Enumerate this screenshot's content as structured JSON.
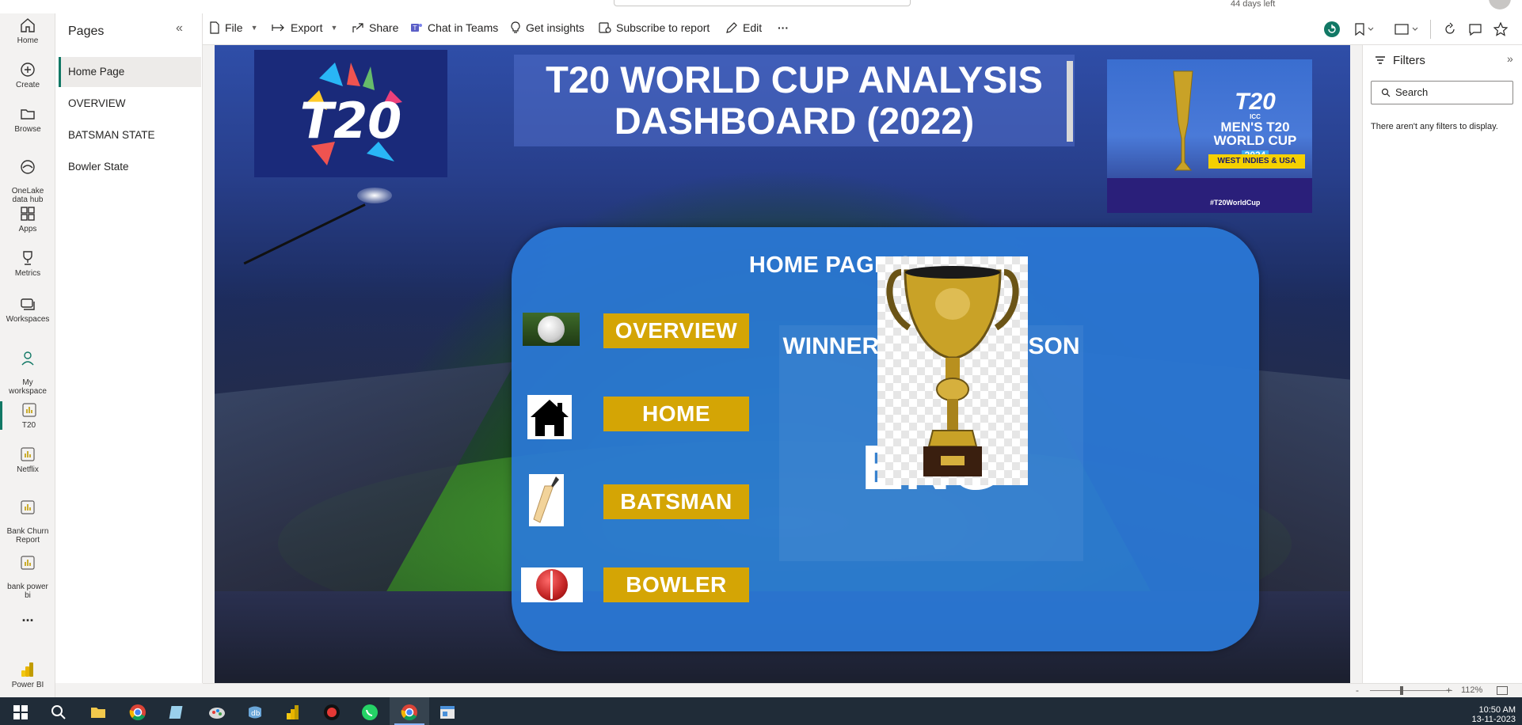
{
  "topbar": {
    "trial_text": "44 days left"
  },
  "rail": {
    "items": [
      {
        "label": "Home"
      },
      {
        "label": "Create"
      },
      {
        "label": "Browse"
      },
      {
        "label": "OneLake\ndata hub"
      },
      {
        "label": "Apps"
      },
      {
        "label": "Metrics"
      },
      {
        "label": "Workspaces"
      },
      {
        "label": "My\nworkspace"
      },
      {
        "label": "T20"
      },
      {
        "label": "Netflix"
      },
      {
        "label": "Bank Churn\nReport"
      },
      {
        "label": "bank power\nbi"
      }
    ],
    "more": "...",
    "brand": "Power BI"
  },
  "pages_pane": {
    "title": "Pages",
    "items": [
      {
        "label": "Home Page",
        "active": true
      },
      {
        "label": "OVERVIEW"
      },
      {
        "label": "BATSMAN STATE"
      },
      {
        "label": "Bowler State"
      }
    ]
  },
  "toolbar": {
    "file": "File",
    "export": "Export",
    "share": "Share",
    "teams": "Chat in Teams",
    "insights": "Get insights",
    "subscribe": "Subscribe to report",
    "edit": "Edit",
    "more": "···"
  },
  "report": {
    "title": "T20 WORLD CUP ANALYSIS\nDASHBOARD (2022)",
    "left_logo_text": "T20",
    "right_logo": {
      "small": "ICC",
      "line1": "MEN'S T20",
      "line2": "WORLD CUP",
      "year": "2024",
      "banner": "WEST INDIES & USA",
      "hashtag": "#T20WorldCup"
    },
    "panel_title": "HOME PAGE OVERVIEW",
    "nav_buttons": [
      "OVERVIEW",
      "HOME",
      "BATSMAN",
      "BOWLER"
    ],
    "winner_label": "WINNER OF THE SEASON",
    "winner_value": "ENG"
  },
  "filters": {
    "title": "Filters",
    "search_placeholder": "Search",
    "empty_text": "There aren't any filters to display."
  },
  "statusbar": {
    "zoom_minus": "-",
    "zoom_plus": "+",
    "zoom": "112%",
    "zoom_level": 0.38
  },
  "taskbar": {
    "time": "10:50 AM",
    "date": "13-11-2023"
  },
  "colors": {
    "accent": "#117865",
    "nav_button": "#d4a505",
    "panel": "#2a78d7"
  }
}
